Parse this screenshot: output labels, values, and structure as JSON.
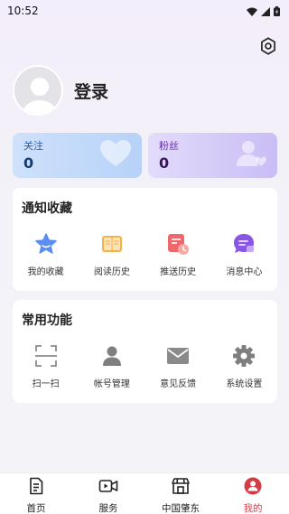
{
  "status_bar": {
    "time": "10:52"
  },
  "profile": {
    "login_text": "登录"
  },
  "stats": {
    "follow": {
      "label": "关注",
      "value": "0"
    },
    "fans": {
      "label": "粉丝",
      "value": "0"
    }
  },
  "notice_section": {
    "title": "通知收藏",
    "items": [
      {
        "label": "我的收藏",
        "icon": "star-icon"
      },
      {
        "label": "阅读历史",
        "icon": "book-icon"
      },
      {
        "label": "推送历史",
        "icon": "push-history-icon"
      },
      {
        "label": "消息中心",
        "icon": "message-icon"
      }
    ]
  },
  "common_section": {
    "title": "常用功能",
    "items": [
      {
        "label": "扫一扫",
        "icon": "scan-icon"
      },
      {
        "label": "帐号管理",
        "icon": "user-icon"
      },
      {
        "label": "意见反馈",
        "icon": "mail-icon"
      },
      {
        "label": "系统设置",
        "icon": "gear-icon"
      }
    ]
  },
  "tabbar": {
    "tabs": [
      {
        "label": "首页",
        "icon": "home-doc-icon"
      },
      {
        "label": "服务",
        "icon": "video-icon"
      },
      {
        "label": "中国肇东",
        "icon": "shop-icon"
      },
      {
        "label": "我的",
        "icon": "profile-icon",
        "active": true
      }
    ]
  },
  "colors": {
    "accent": "#d63c45",
    "follow_text": "#2a5db0",
    "fans_text": "#6a2fa8"
  }
}
